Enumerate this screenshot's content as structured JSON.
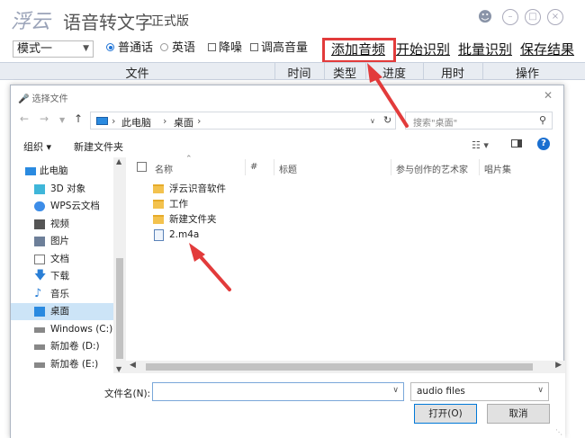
{
  "app": {
    "logo": "浮云",
    "title": "语音转文字",
    "edition": "正式版"
  },
  "header_icons": [
    "user-icon",
    "minimize-icon",
    "maximize-icon",
    "close-icon"
  ],
  "toolbar": {
    "mode": "模式一",
    "options": [
      "普通话",
      "英语"
    ],
    "selected_option": "普通话",
    "checks": [
      "降噪",
      "调高音量"
    ],
    "actions": [
      "添加音频",
      "开始识别",
      "批量识别",
      "保存结果"
    ]
  },
  "table": {
    "columns": [
      "文件",
      "时间",
      "类型",
      "进度",
      "用时",
      "操作"
    ]
  },
  "dialog": {
    "title": "选择文件",
    "breadcrumb": [
      "此电脑",
      "桌面"
    ],
    "search_placeholder": "搜索\"桌面\"",
    "commands": {
      "organize": "组织 ▾",
      "new_folder": "新建文件夹"
    },
    "nav_items": [
      "此电脑",
      "3D 对象",
      "WPS云文档",
      "视频",
      "图片",
      "文档",
      "下载",
      "音乐",
      "桌面",
      "Windows (C:)",
      "新加卷 (D:)",
      "新加卷 (E:)"
    ],
    "selected_nav": "桌面",
    "columns": [
      "名称",
      "#",
      "标题",
      "参与创作的艺术家",
      "唱片集"
    ],
    "files": [
      {
        "name": "浮云识音软件",
        "kind": "folder"
      },
      {
        "name": "工作",
        "kind": "folder"
      },
      {
        "name": "新建文件夹",
        "kind": "folder"
      },
      {
        "name": "2.m4a",
        "kind": "audio"
      }
    ],
    "filename_label": "文件名(N):",
    "filename_value": "",
    "file_type": "audio files",
    "open_button": "打开(O)",
    "cancel_button": "取消"
  },
  "colors": {
    "highlight": "#e23b3b",
    "selection": "#cce4f7",
    "header_bg": "#e8ecf2"
  }
}
